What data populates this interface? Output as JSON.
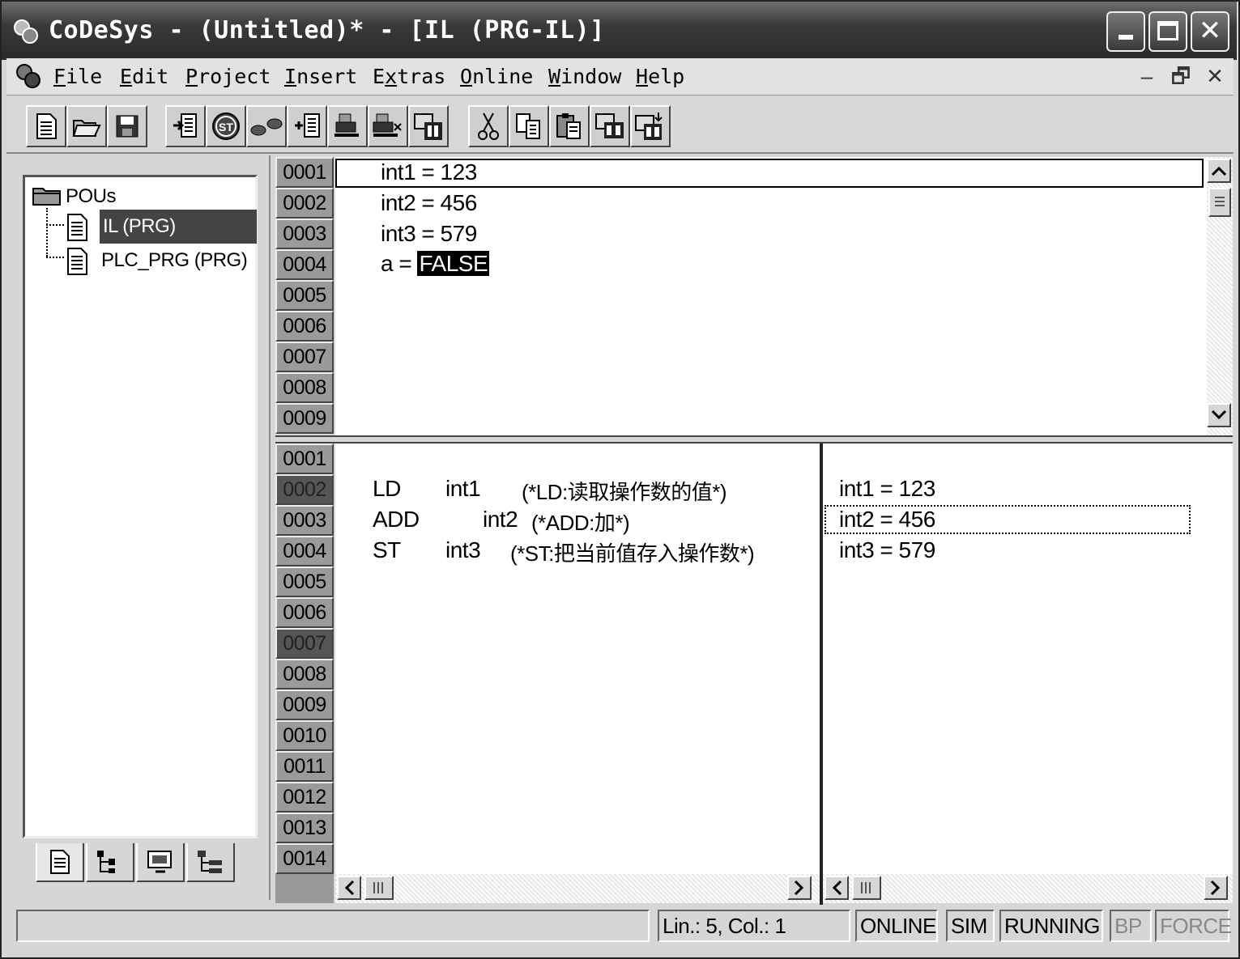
{
  "window": {
    "title": "CoDeSys - (Untitled)* - [IL (PRG-IL)]",
    "controls": [
      "minimize",
      "maximize",
      "close"
    ]
  },
  "menubar": {
    "items": [
      {
        "label": "File",
        "mnemonic": "F",
        "rest": "ile"
      },
      {
        "label": "Edit",
        "mnemonic": "E",
        "rest": "dit"
      },
      {
        "label": "Project",
        "mnemonic": "P",
        "rest": "roject"
      },
      {
        "label": "Insert",
        "mnemonic": "I",
        "rest": "nsert"
      },
      {
        "label": "Extras",
        "mnemonic": "x",
        "pre": "E",
        "rest": "tras"
      },
      {
        "label": "Online",
        "mnemonic": "O",
        "rest": "nline"
      },
      {
        "label": "Window",
        "mnemonic": "W",
        "rest": "indow"
      },
      {
        "label": "Help",
        "mnemonic": "H",
        "rest": "elp"
      }
    ],
    "mdi_controls": [
      "–",
      "🗗",
      "✕"
    ]
  },
  "toolbar": {
    "icons": [
      "new-file-icon",
      "open-folder-icon",
      "save-icon",
      "login-icon",
      "stop-icon",
      "run-icon",
      "step-in-icon",
      "breakpoint-icon",
      "reset-icon",
      "monitor-icon",
      "cut-icon",
      "copy-icon",
      "paste-icon",
      "find-icon",
      "find-next-icon"
    ]
  },
  "tree": {
    "root": "POUs",
    "items": [
      {
        "label": "IL (PRG)",
        "selected": true
      },
      {
        "label": "PLC_PRG (PRG)",
        "selected": false
      }
    ],
    "tabs": [
      "pous-tab-icon",
      "data-types-tab-icon",
      "visualizations-tab-icon",
      "resources-tab-icon"
    ]
  },
  "declaration": {
    "line_numbers": [
      "0001",
      "0002",
      "0003",
      "0004",
      "0005",
      "0006",
      "0007",
      "0008",
      "0009"
    ],
    "lines": [
      {
        "text": "int1 = 123"
      },
      {
        "text": "int2 = 456"
      },
      {
        "text": "int3 = 579"
      },
      {
        "prefix": "a = ",
        "value": "FALSE"
      }
    ]
  },
  "code": {
    "line_numbers": [
      "0001",
      "0002",
      "0003",
      "0004",
      "0005",
      "0006",
      "0007",
      "0008",
      "0009",
      "0010",
      "0011",
      "0012",
      "0013",
      "0014"
    ],
    "dark_lines": [
      "0002",
      "0007"
    ],
    "lines": [
      {
        "op": "LD",
        "arg": "int1",
        "comment": "(*LD:读取操作数的值*)"
      },
      {
        "op": "ADD",
        "arg": "int2",
        "comment": "(*ADD:加*)"
      },
      {
        "op": "ST",
        "arg": "int3",
        "comment": "(*ST:把当前值存入操作数*)"
      }
    ]
  },
  "monitor": {
    "lines": [
      "int1 = 123",
      "int2 = 456",
      "int3 = 579"
    ]
  },
  "statusbar": {
    "position": "Lin.: 5, Col.: 1",
    "online": "ONLINE",
    "sim": "SIM",
    "running": "RUNNING",
    "bp": "BP",
    "force": "FORCE"
  }
}
